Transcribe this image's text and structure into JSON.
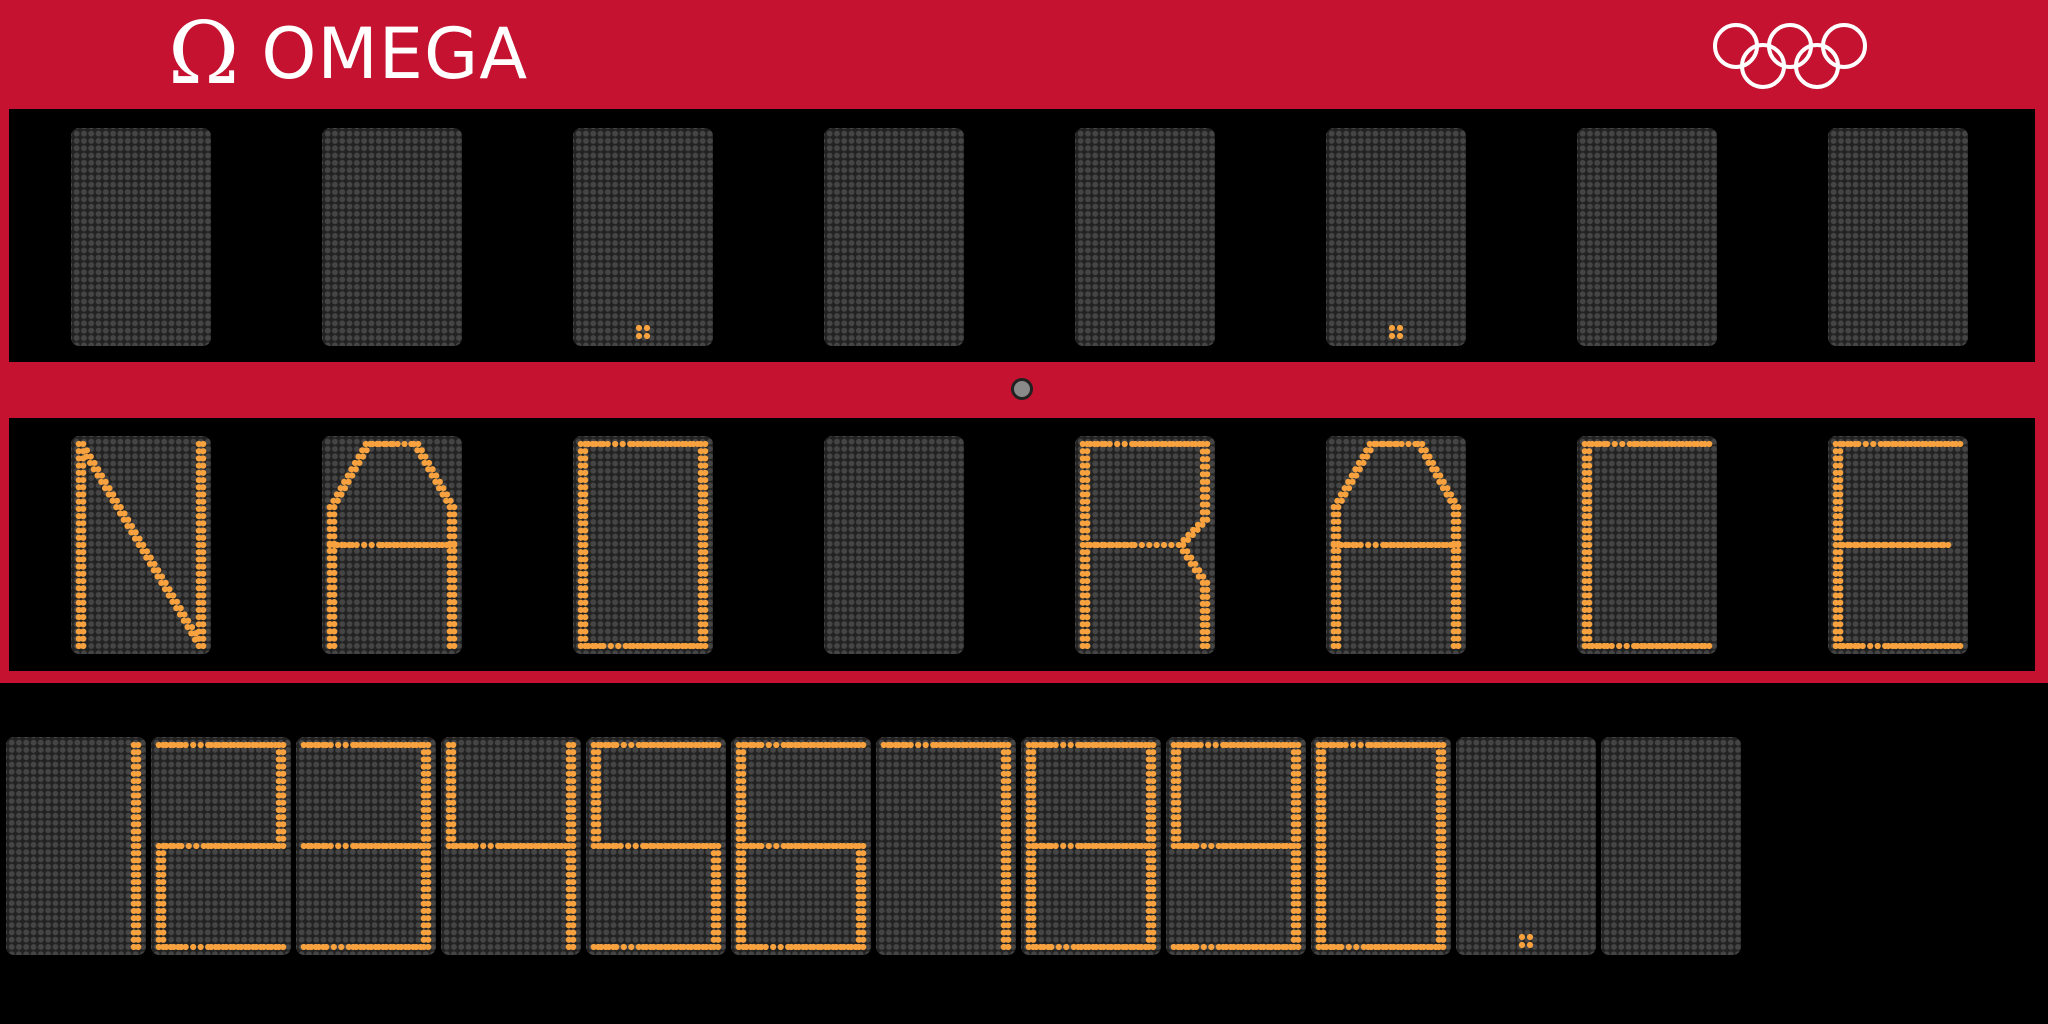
{
  "brand": {
    "logo_symbol": "Ω",
    "logo_text": "OMEGA",
    "logo_color": "#ffffff",
    "rings_icon": "olympic-rings-icon"
  },
  "colors": {
    "frame": "#c41230",
    "background": "#000000",
    "led_on": "#f7a23e",
    "led_off": "#454545",
    "indicator": "#8a8a8a"
  },
  "rows": {
    "top": {
      "chars": [
        " ",
        " ",
        ".",
        " ",
        " ",
        ".",
        " ",
        " "
      ]
    },
    "middle": {
      "chars": [
        "N",
        "A",
        "O",
        " ",
        "R",
        "A",
        "C",
        "E"
      ]
    },
    "bottom": {
      "chars": [
        "1",
        "2",
        "3",
        "4",
        "5",
        "6",
        "7",
        "8",
        "9",
        "0",
        ".",
        " "
      ]
    }
  }
}
